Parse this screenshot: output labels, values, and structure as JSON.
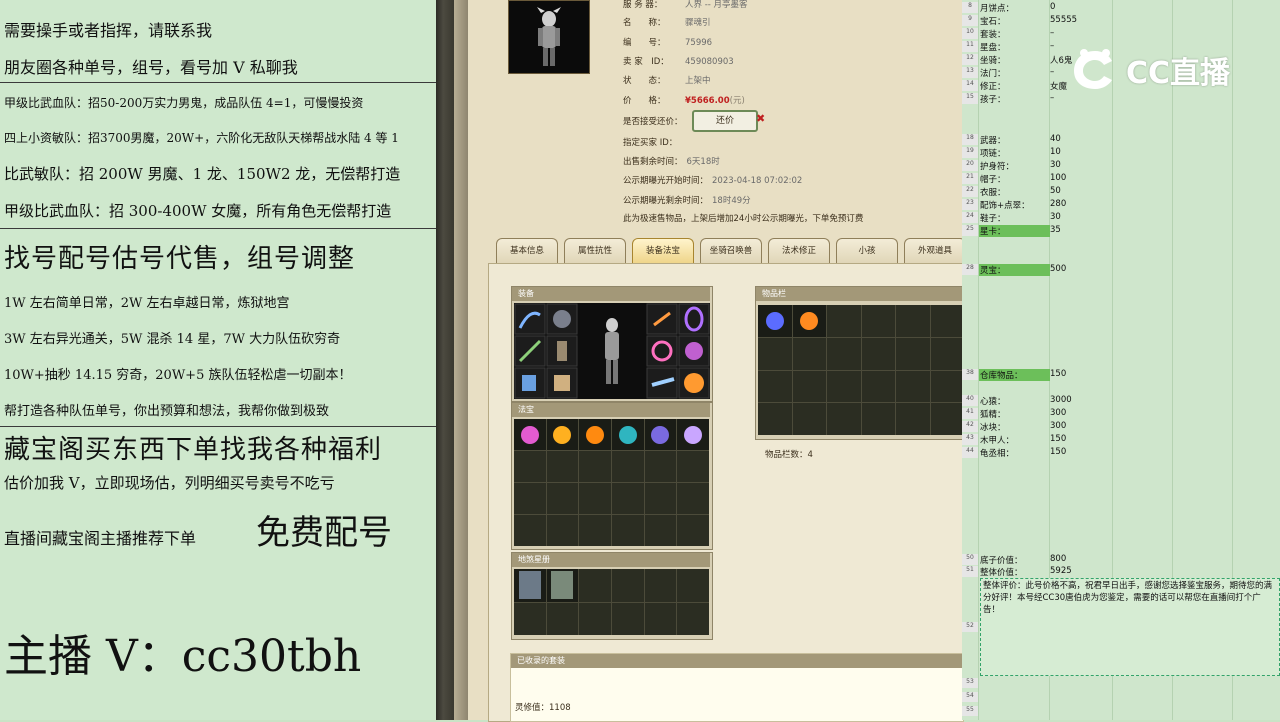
{
  "left_panel": {
    "lines": [
      "需要操手或者指挥，请联系我",
      "朋友圈各种单号，组号，看号加 V 私聊我",
      "甲级比武血队：招50-200万实力男鬼，成品队伍 4=1，可慢慢投资",
      "四上小资敏队：招3700男魔，20W+，六阶化无敌队天梯帮战水陆 4 等 1",
      "比武敏队：招 200W 男魔、1 龙、150W2 龙，无偿帮打造",
      "甲级比武血队：招 300-400W 女魔，所有角色无偿帮打造",
      "找号配号估号代售，组号调整",
      "1W 左右简单日常，2W 左右卓越日常，炼狱地宫",
      "3W 左右异光通关，5W 混杀 14 星，7W 大力队伍砍穷奇",
      "10W+抽秒 14.15 穷奇，20W+5 族队伍轻松虐一切副本！",
      "帮打造各种队伍单号，你出预算和想法，我帮你做到极致",
      "藏宝阁买东西下单找我各种福利",
      "估价加我 V，立即现场估，列明细买号卖号不吃亏",
      "直播间藏宝阁主播推荐下单",
      "免费配号",
      "主播 V：cc30tbh"
    ]
  },
  "game": {
    "info": [
      {
        "k": "服 务 器：",
        "v": "人界 -- 月亭墨客"
      },
      {
        "k": "名　　称：",
        "v": "骤魂引"
      },
      {
        "k": "编　　号：",
        "v": "75996"
      },
      {
        "k": "卖 家　ID：",
        "v": "459080903"
      },
      {
        "k": "状　　态：",
        "v": "上架中"
      }
    ],
    "price_label": "价　　格：",
    "price_value": "¥5666.00",
    "price_unit": "(元)",
    "accept_offer_label": "是否接受还价：",
    "offer_button": "还价",
    "buyer_label": "指定买家 ID：",
    "time_rows": [
      {
        "k": "出售剩余时间：",
        "v": "6天18时"
      },
      {
        "k": "公示期曝光开始时间：",
        "v": "2023-04-18 07:02:02"
      },
      {
        "k": "公示期曝光剩余时间：",
        "v": "18时49分"
      }
    ],
    "notice": "此为极速售物品，上架后增加24小时公示期曝光，下单免预订费",
    "tabs": [
      "基本信息",
      "属性抗性",
      "装备法宝",
      "坐骑召唤兽",
      "法术修正",
      "小孩",
      "外观道具"
    ],
    "active_tab": "装备法宝",
    "equip_title": "装备",
    "fabao_title": "法宝",
    "card_title": "地煞星册",
    "items_title": "物品栏",
    "items_count": "物品栏数：4",
    "collected_title": "已收录的套装",
    "lingxiu": "灵修值：1108"
  },
  "sheet": {
    "rows": [
      {
        "n": "8",
        "label": "月饼点：",
        "value": "0",
        "hl": false
      },
      {
        "n": "9",
        "label": "宝石：",
        "value": "55555",
        "hl": false
      },
      {
        "n": "10",
        "label": "套装：",
        "value": "–",
        "hl": false
      },
      {
        "n": "11",
        "label": "星盘：",
        "value": "–",
        "hl": false
      },
      {
        "n": "12",
        "label": "坐骑：",
        "value": "人6鬼",
        "hl": false
      },
      {
        "n": "13",
        "label": "法门：",
        "value": "–",
        "hl": false
      },
      {
        "n": "14",
        "label": "修正：",
        "value": "女魔",
        "hl": false
      },
      {
        "n": "15",
        "label": "孩子：",
        "value": "–",
        "hl": false
      },
      {
        "n": "18",
        "label": "武器：",
        "value": "40",
        "hl": false
      },
      {
        "n": "19",
        "label": "项链：",
        "value": "10",
        "hl": false
      },
      {
        "n": "20",
        "label": "护身符：",
        "value": "30",
        "hl": false
      },
      {
        "n": "21",
        "label": "帽子：",
        "value": "100",
        "hl": false
      },
      {
        "n": "22",
        "label": "衣服：",
        "value": "50",
        "hl": false
      },
      {
        "n": "23",
        "label": "配饰+点翠：",
        "value": "280",
        "hl": false
      },
      {
        "n": "24",
        "label": "鞋子：",
        "value": "30",
        "hl": false
      },
      {
        "n": "25",
        "label": "星卡：",
        "value": "35",
        "hl": true
      },
      {
        "n": "28",
        "label": "灵宝：",
        "value": "500",
        "hl": true
      },
      {
        "n": "38",
        "label": "仓库物品：",
        "value": "150",
        "hl": true
      },
      {
        "n": "40",
        "label": "心猿：",
        "value": "3000",
        "hl": false
      },
      {
        "n": "41",
        "label": "狐精：",
        "value": "300",
        "hl": false
      },
      {
        "n": "42",
        "label": "冰块：",
        "value": "300",
        "hl": false
      },
      {
        "n": "43",
        "label": "木甲人：",
        "value": "150",
        "hl": false
      },
      {
        "n": "44",
        "label": "龟丞相：",
        "value": "150",
        "hl": false
      },
      {
        "n": "50",
        "label": "底子价值：",
        "value": "800",
        "hl": false
      },
      {
        "n": "51",
        "label": "整体价值：",
        "value": "5925",
        "hl": false
      }
    ],
    "comment": "整体评价：此号价格不高，祝君早日出手，感谢您选择鉴宝服务，期待您的满分好评！本号经CC30唐伯虎为您鉴定，需要的话可以帮您在直播间打个广告！",
    "footer_rows": [
      "52",
      "53",
      "54",
      "55"
    ]
  },
  "logo": {
    "text": "CC直播"
  }
}
